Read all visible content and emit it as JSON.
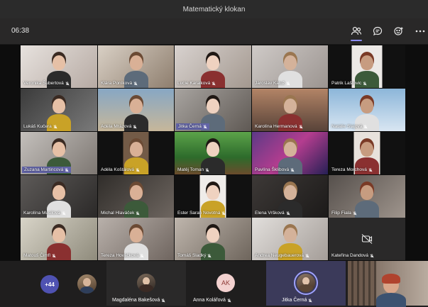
{
  "window": {
    "title": "Matematický klokan"
  },
  "toolbar": {
    "timer": "06:38",
    "icons": [
      "participants-icon",
      "chat-icon",
      "reactions-icon",
      "more-actions-icon"
    ],
    "accent": "#6264a7"
  },
  "participants": [
    {
      "name": "Veronika Šubertová"
    },
    {
      "name": "Klára Poníková"
    },
    {
      "name": "Lucie Karalková"
    },
    {
      "name": "Jaroslav Kaluž"
    },
    {
      "name": "Patrik Laštovic"
    },
    {
      "name": "Lukáš Kučera"
    },
    {
      "name": "Adéla Mrázová"
    },
    {
      "name": "Jitka Černá"
    },
    {
      "name": "Karolína Hermanová"
    },
    {
      "name": "Natálie Slajová"
    },
    {
      "name": "Zuzana Martincová"
    },
    {
      "name": "Adéla Koštálová"
    },
    {
      "name": "Matěj Toman"
    },
    {
      "name": "Pavlína Šklibová"
    },
    {
      "name": "Tereza Morchová"
    },
    {
      "name": "Karolína Musilová"
    },
    {
      "name": "Michal Hlaváček"
    },
    {
      "name": "Ester Sarah Novotná"
    },
    {
      "name": "Elena Vršková"
    },
    {
      "name": "Filip Fiala"
    },
    {
      "name": "Matouš Čimfl"
    },
    {
      "name": "Tereza Hováčková"
    },
    {
      "name": "Tomáš Sladký"
    },
    {
      "name": "Andrea Neugebauerová"
    },
    {
      "name": "Kateřina Dandová"
    }
  ],
  "strip": {
    "overflow": "+44",
    "people": [
      {
        "name": "Magdaléna Bakešová"
      },
      {
        "name": "Anna Kolářová",
        "initials": "AK"
      },
      {
        "name": "Jitka Černá"
      }
    ]
  }
}
